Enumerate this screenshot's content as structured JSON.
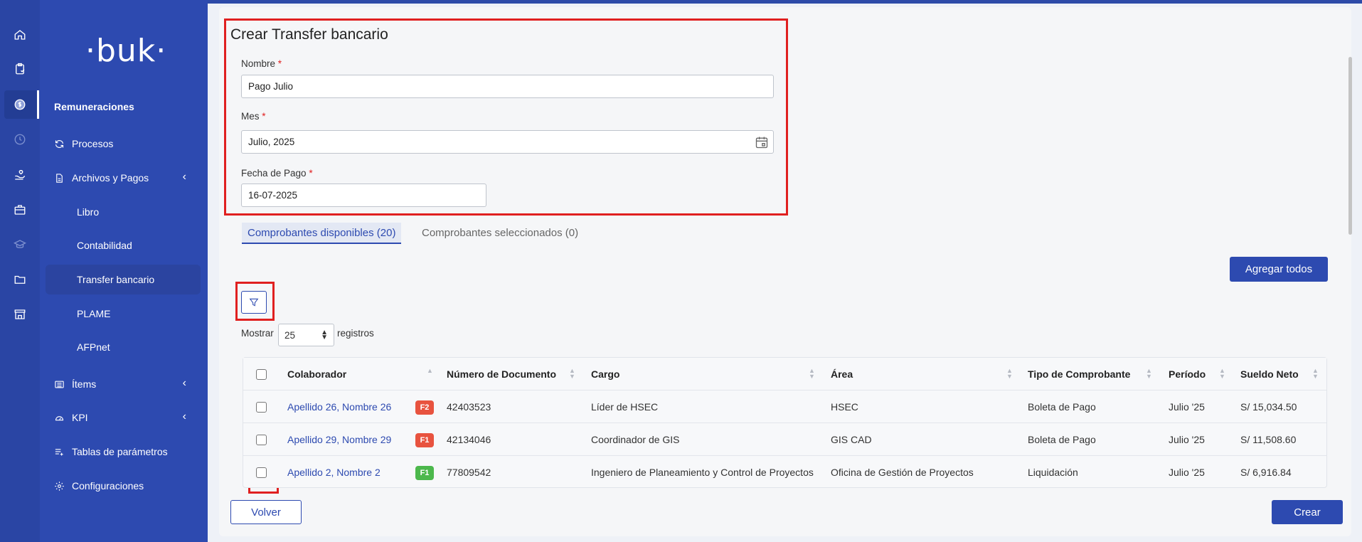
{
  "app": {
    "logo": "·buk·",
    "section": "Remuneraciones"
  },
  "rail_icons": [
    "home-icon",
    "clipboard-icon",
    "money-icon",
    "clock-icon",
    "hand-heart-icon",
    "briefcase-icon",
    "graduation-icon",
    "folder-icon",
    "store-icon"
  ],
  "nav": {
    "items": [
      {
        "label": "Procesos",
        "icon": "refresh-icon"
      },
      {
        "label": "Archivos y Pagos",
        "icon": "document-icon"
      },
      {
        "label": "Ítems",
        "icon": "list-icon"
      },
      {
        "label": "KPI",
        "icon": "gauge-icon"
      },
      {
        "label": "Tablas de parámetros",
        "icon": "table-add-icon"
      },
      {
        "label": "Configuraciones",
        "icon": "gear-icon"
      }
    ],
    "sub_items": [
      "Libro",
      "Contabilidad",
      "Transfer bancario",
      "PLAME",
      "AFPnet"
    ],
    "active_sub": "Transfer bancario"
  },
  "form": {
    "title": "Crear Transfer bancario",
    "name_label": "Nombre",
    "name_value": "Pago Julio",
    "month_label": "Mes",
    "month_value": "Julio, 2025",
    "paydate_label": "Fecha de Pago",
    "paydate_value": "16-07-2025",
    "required_mark": "*"
  },
  "tabs": [
    {
      "label": "Comprobantes disponibles (20)",
      "active": true
    },
    {
      "label": "Comprobantes seleccionados (0)",
      "active": false
    }
  ],
  "actions": {
    "add_all": "Agregar todos",
    "back": "Volver",
    "create": "Crear"
  },
  "pagination": {
    "show_label": "Mostrar",
    "page_size": "25",
    "records_label": "registros"
  },
  "table": {
    "columns": [
      "Colaborador",
      "Número de Documento",
      "Cargo",
      "Área",
      "Tipo de Comprobante",
      "Período",
      "Sueldo Neto"
    ],
    "rows": [
      {
        "colaborador": "Apellido 26, Nombre 26",
        "badge": "F2",
        "badge_color": "#e8533f",
        "documento": "42403523",
        "cargo": "Líder de HSEC",
        "area": "HSEC",
        "tipo": "Boleta de Pago",
        "periodo": "Julio '25",
        "sueldo": "S/ 15,034.50"
      },
      {
        "colaborador": "Apellido 29, Nombre 29",
        "badge": "F1",
        "badge_color": "#e8533f",
        "documento": "42134046",
        "cargo": "Coordinador de GIS",
        "area": "GIS CAD",
        "tipo": "Boleta de Pago",
        "periodo": "Julio '25",
        "sueldo": "S/ 11,508.60"
      },
      {
        "colaborador": "Apellido 2, Nombre 2",
        "badge": "F1",
        "badge_color": "#4cb84c",
        "documento": "77809542",
        "cargo": "Ingeniero de Planeamiento y Control de Proyectos",
        "area": "Oficina de Gestión de Proyectos",
        "tipo": "Liquidación",
        "periodo": "Julio '25",
        "sueldo": "S/ 6,916.84"
      }
    ]
  },
  "colors": {
    "primary": "#2d4ab0",
    "highlight": "#e02020",
    "sidebar": "#2d4ab0"
  }
}
